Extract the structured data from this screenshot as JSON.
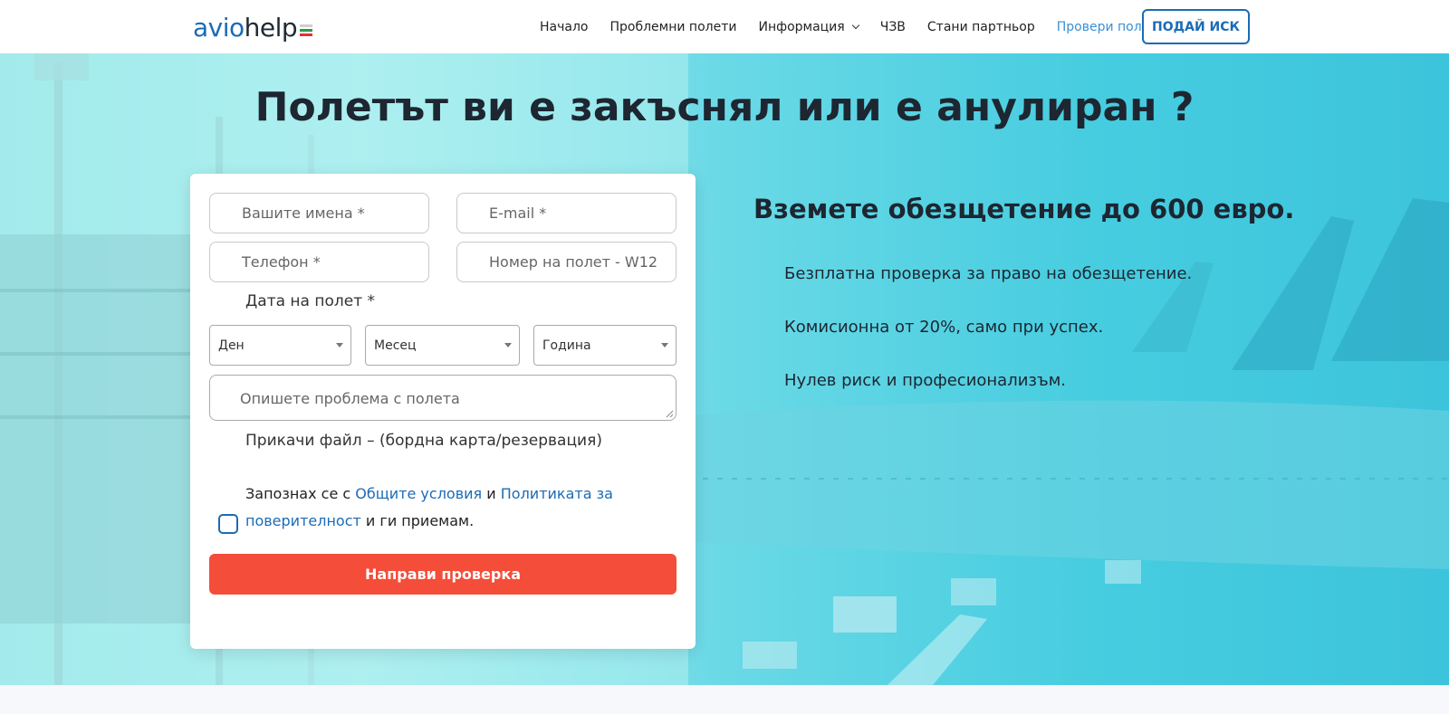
{
  "header": {
    "logo": {
      "part1": "avio",
      "part2": "help"
    },
    "nav": [
      {
        "label": "Начало"
      },
      {
        "label": "Проблемни полети"
      },
      {
        "label": "Информация"
      },
      {
        "label": "ЧЗВ"
      },
      {
        "label": "Стани партньор"
      },
      {
        "label": "Провери полет"
      }
    ],
    "cta_label": "ПОДАЙ ИСК"
  },
  "hero": {
    "title": "Полетът ви е закъснял или е анулиран ?",
    "promo_title": "Вземете обезщетение до 600 евро.",
    "benefits": [
      "Безплатна проверка за право на обезщетение.",
      "Комисионна от 20%, само при успех.",
      "Нулев риск и професионализъм."
    ]
  },
  "form": {
    "name_placeholder": "Вашите имена *",
    "email_placeholder": "E-mail *",
    "phone_placeholder": "Телефон *",
    "flight_placeholder": "Номер на полет - W12",
    "date_label": "Дата на полет *",
    "day_select": "Ден",
    "month_select": "Месец",
    "year_select": "Година",
    "description_placeholder": "Опишете проблема с полета",
    "attach_label": "Прикачи файл – (бордна карта/резервация)",
    "consent": {
      "text1": "Запознах се с ",
      "link1": "Общите условия",
      "text2": " и ",
      "link2": "Политиката за поверителност",
      "text3": " и ги приемам."
    },
    "submit_label": "Направи проверка"
  },
  "colors": {
    "brand_blue": "#1b6bb6",
    "submit_red": "#f44d3a",
    "hero_cyan": "#47cde0"
  }
}
